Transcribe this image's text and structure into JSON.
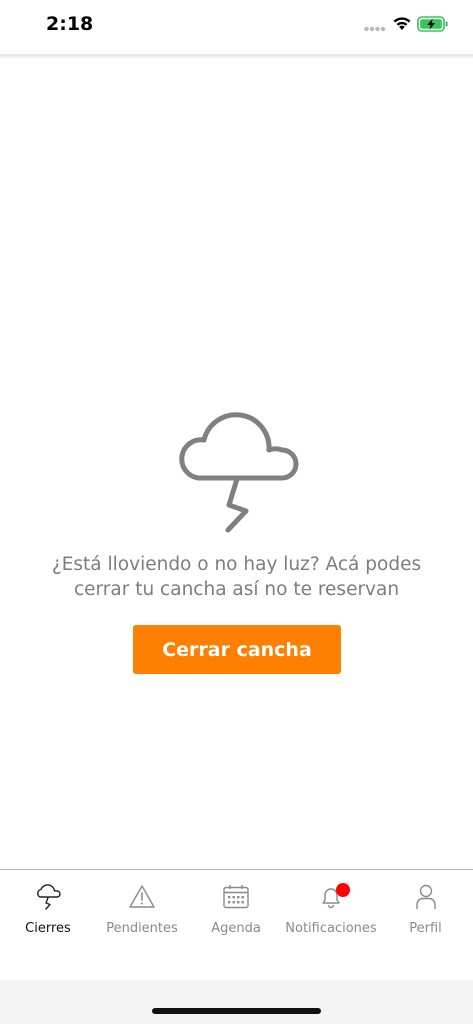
{
  "status_bar": {
    "time": "2:18"
  },
  "empty_state": {
    "icon": "storm-cloud-icon",
    "message_line1": "¿Está lloviendo o no hay luz? Acá podes",
    "message_line2": "cerrar tu cancha así no te reservan",
    "button_label": "Cerrar cancha"
  },
  "tabs": [
    {
      "label": "Cierres",
      "icon": "storm-cloud-icon",
      "active": true
    },
    {
      "label": "Pendientes",
      "icon": "warning-icon",
      "active": false
    },
    {
      "label": "Agenda",
      "icon": "calendar-icon",
      "active": false
    },
    {
      "label": "Notificaciones",
      "icon": "bell-icon",
      "active": false,
      "badge": true
    },
    {
      "label": "Perfil",
      "icon": "user-icon",
      "active": false
    }
  ],
  "colors": {
    "accent": "#ff8000",
    "badge": "#ff0000",
    "icon_gray": "#8a8a8a",
    "battery_green": "#35c759"
  }
}
